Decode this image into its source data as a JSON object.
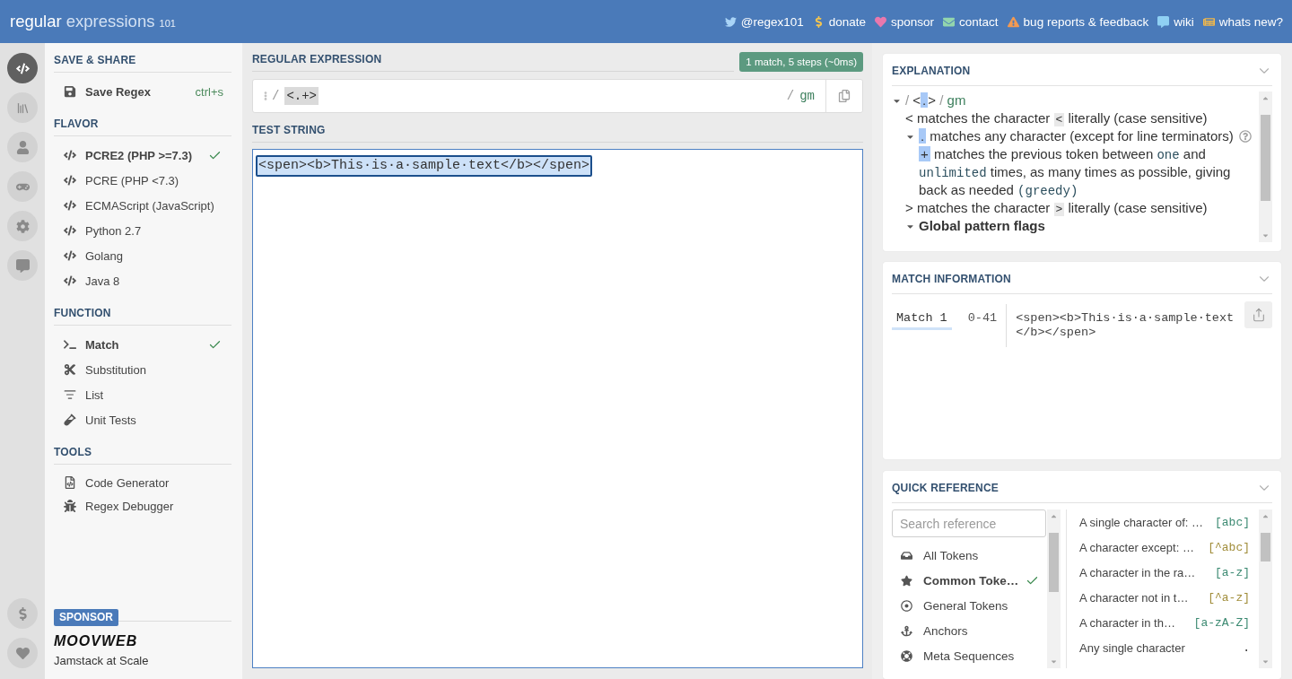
{
  "header": {
    "logo": [
      "regular",
      "expressions",
      "101"
    ],
    "links": [
      {
        "label": "@regex101"
      },
      {
        "label": "donate"
      },
      {
        "label": "sponsor"
      },
      {
        "label": "contact"
      },
      {
        "label": "bug reports & feedback"
      },
      {
        "label": "wiki"
      },
      {
        "label": "whats new?"
      }
    ]
  },
  "rail": [
    {
      "selected": true
    },
    {
      "selected": false
    },
    {
      "selected": false
    },
    {
      "selected": false
    },
    {
      "selected": false
    },
    {
      "selected": false
    }
  ],
  "sidebar": {
    "sections": [
      {
        "kind": "save",
        "title": "SAVE & SHARE",
        "items": [
          {
            "label": "Save Regex",
            "shortcut": "ctrl+s"
          }
        ]
      },
      {
        "kind": "options",
        "title": "FLAVOR",
        "items": [
          {
            "label": "PCRE2 (PHP >=7.3)",
            "selected": true
          },
          {
            "label": "PCRE (PHP <7.3)",
            "selected": false
          },
          {
            "label": "ECMAScript (JavaScript)",
            "selected": false
          },
          {
            "label": "Python 2.7",
            "selected": false
          },
          {
            "label": "Golang",
            "selected": false
          },
          {
            "label": "Java 8",
            "selected": false
          }
        ]
      },
      {
        "kind": "options",
        "title": "FUNCTION",
        "items": [
          {
            "label": "Match",
            "selected": true
          },
          {
            "label": "Substitution",
            "selected": false
          },
          {
            "label": "List",
            "selected": false
          },
          {
            "label": "Unit Tests",
            "selected": false
          }
        ]
      },
      {
        "kind": "links",
        "title": "TOOLS",
        "items": [
          {
            "label": "Code Generator"
          },
          {
            "label": "Regex Debugger"
          }
        ]
      }
    ],
    "sponsor": {
      "badge": "SPONSOR",
      "logo": "MOOVWEB",
      "tagline": "Jamstack at Scale"
    }
  },
  "regex_panel": {
    "title": "REGULAR EXPRESSION",
    "status": "1 match, 5 steps (~0ms)",
    "open_delimiter": "/",
    "pattern": "<.+>",
    "close_delimiter": "/",
    "flags": "gm"
  },
  "test_panel": {
    "title": "TEST STRING",
    "segments": [
      {
        "text": "<spen><b>This·is·a·sample·text</b></spen>",
        "matched": true
      }
    ]
  },
  "explanation": {
    "title": "EXPLANATION",
    "tree": [
      {
        "expanded": true,
        "parts": [
          {
            "kind": "delim",
            "text": "/ "
          },
          {
            "kind": "text",
            "text": "<"
          },
          {
            "kind": "token",
            "text": "."
          },
          {
            "kind": "text",
            "text": ">"
          },
          {
            "kind": "delim",
            "text": " / "
          },
          {
            "kind": "flags",
            "text": "gm"
          }
        ],
        "children": [
          {
            "parts": [
              {
                "kind": "text",
                "text": "< matches the character "
              },
              {
                "kind": "code",
                "text": "<"
              },
              {
                "kind": "text",
                "text": " literally (case sensitive)"
              }
            ]
          },
          {
            "expanded": true,
            "help": true,
            "parts": [
              {
                "kind": "token",
                "text": "."
              },
              {
                "kind": "text",
                "text": " matches any character (except for line terminators)"
              }
            ],
            "children": [
              {
                "parts": [
                  {
                    "kind": "token",
                    "text": "+"
                  },
                  {
                    "kind": "text",
                    "text": " matches the previous token between "
                  },
                  {
                    "kind": "mono",
                    "text": "one"
                  },
                  {
                    "kind": "text",
                    "text": " and "
                  },
                  {
                    "kind": "mono",
                    "text": "unlimited"
                  },
                  {
                    "kind": "text",
                    "text": " times, as many times as possible, giving back as needed "
                  },
                  {
                    "kind": "mono",
                    "text": "(greedy)"
                  }
                ]
              }
            ]
          },
          {
            "parts": [
              {
                "kind": "text",
                "text": "> matches the character "
              },
              {
                "kind": "code",
                "text": ">"
              },
              {
                "kind": "text",
                "text": " literally (case sensitive)"
              }
            ]
          },
          {
            "expanded": true,
            "parts": [
              {
                "kind": "bold",
                "text": "Global pattern flags"
              }
            ]
          }
        ]
      }
    ]
  },
  "match_information": {
    "title": "MATCH INFORMATION",
    "matches": [
      {
        "label": "Match 1",
        "range": "0-41",
        "text": "<spen><b>This·is·a·sample·text</b></spen>"
      }
    ]
  },
  "quick_reference": {
    "title": "QUICK REFERENCE",
    "search": {
      "placeholder": "Search reference"
    },
    "categories": [
      {
        "label": "All Tokens",
        "selected": false
      },
      {
        "label": "Common Toke…",
        "selected": true
      },
      {
        "label": "General Tokens",
        "selected": false
      },
      {
        "label": "Anchors",
        "selected": false
      },
      {
        "label": "Meta Sequences",
        "selected": false
      }
    ],
    "tokens": [
      {
        "description": "A single character of: …",
        "token": "[abc]",
        "color": "#3c8a72"
      },
      {
        "description": "A character except: …",
        "token": "[^abc]",
        "color": "#a18d3a"
      },
      {
        "description": "A character in the ra…",
        "token": "[a-z]",
        "color": "#3c8a72"
      },
      {
        "description": "A character not in t…",
        "token": "[^a-z]",
        "color": "#a18d3a"
      },
      {
        "description": "A character in th…",
        "token": "[a-zA-Z]",
        "color": "#3c8a72"
      },
      {
        "description": "Any single character",
        "token": "."
      }
    ]
  }
}
